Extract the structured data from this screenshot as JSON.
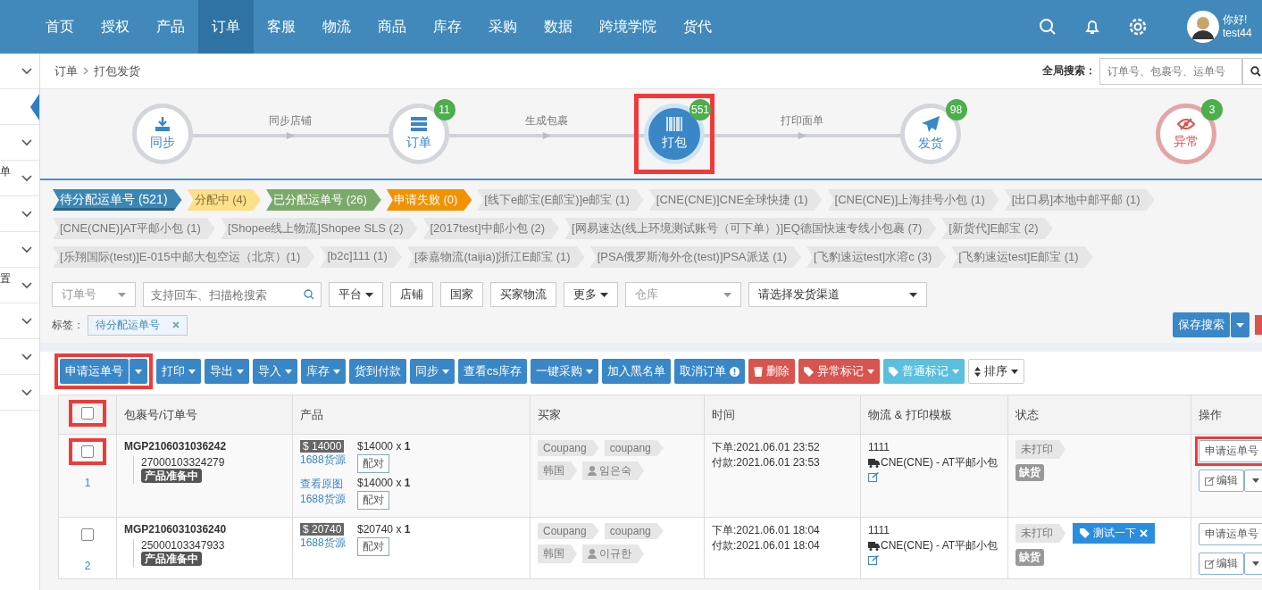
{
  "nav": {
    "items": [
      {
        "label": "首页",
        "selected": false
      },
      {
        "label": "授权",
        "selected": false
      },
      {
        "label": "产品",
        "selected": false
      },
      {
        "label": "订单",
        "selected": true
      },
      {
        "label": "客服",
        "selected": false
      },
      {
        "label": "物流",
        "selected": false
      },
      {
        "label": "商品",
        "selected": false
      },
      {
        "label": "库存",
        "selected": false
      },
      {
        "label": "采购",
        "selected": false
      },
      {
        "label": "数据",
        "selected": false
      },
      {
        "label": "跨境学院",
        "selected": false
      },
      {
        "label": "货代",
        "selected": false
      }
    ],
    "user": {
      "greeting": "你好!",
      "name": "test44"
    }
  },
  "sidebar": {
    "items": [
      {
        "kind": "chevron",
        "selected": false
      },
      {
        "kind": "blank",
        "selected": true
      },
      {
        "kind": "chevron",
        "selected": false
      },
      {
        "kind": "text",
        "text": "单",
        "selected": false
      },
      {
        "kind": "chevron",
        "selected": false
      },
      {
        "kind": "chevron",
        "selected": false
      },
      {
        "kind": "text",
        "text": "置",
        "selected": false
      },
      {
        "kind": "chevron",
        "selected": false
      },
      {
        "kind": "chevron",
        "selected": false
      },
      {
        "kind": "chevron",
        "selected": false
      }
    ]
  },
  "breadcrumb": [
    "订单",
    "打包发货"
  ],
  "global_search": {
    "label": "全局搜索：",
    "placeholder": "订单号、包裹号、运单号"
  },
  "steps": [
    {
      "label": "同步",
      "kind": "normal",
      "highlighted": false
    },
    {
      "label": "订单",
      "kind": "normal",
      "badge": "11",
      "connector": "同步店铺",
      "highlighted": false
    },
    {
      "label": "打包",
      "kind": "active",
      "badge": "551",
      "connector": "生成包裹",
      "highlighted": true
    },
    {
      "label": "发货",
      "kind": "normal",
      "badge": "98",
      "connector": "打印面单",
      "highlighted": false
    },
    {
      "label": "异常",
      "kind": "danger",
      "badge": "3",
      "highlighted": false
    }
  ],
  "status_tags": [
    {
      "label": "待分配运单号 (521)",
      "color": "#3a87b5",
      "selected": true
    },
    {
      "label": "分配中 (4)",
      "color": "#fde08a",
      "selected": false
    },
    {
      "label": "已分配运单号 (26)",
      "color": "#7aaa6a",
      "selected": false
    },
    {
      "label": "申请失败 (0)",
      "color": "#f39200",
      "selected": false
    },
    {
      "label": "[线下e邮宝(E邮宝)]e邮宝 (1)",
      "color": "#e6e6e6",
      "selected": false
    },
    {
      "label": "[CNE(CNE)]CNE全球快捷 (1)",
      "color": "#e6e6e6",
      "selected": false
    },
    {
      "label": "[CNE(CNE)]上海挂号小包 (1)",
      "color": "#e6e6e6",
      "selected": false
    },
    {
      "label": "[出口易]本地中邮平邮 (1)",
      "color": "#e6e6e6",
      "selected": false
    },
    {
      "label": "[CNE(CNE)]AT平邮小包 (1)",
      "color": "#e6e6e6",
      "selected": false
    },
    {
      "label": "[Shopee线上物流]Shopee SLS (2)",
      "color": "#e6e6e6",
      "selected": false
    },
    {
      "label": "[2017test]中邮小包 (2)",
      "color": "#e6e6e6",
      "selected": false
    },
    {
      "label": "[网易速达(线上环境测试账号（可下单）)]EQ德国快速专线小包裹 (7)",
      "color": "#e6e6e6",
      "selected": false
    },
    {
      "label": "[新货代]E邮宝 (2)",
      "color": "#e6e6e6",
      "selected": false
    },
    {
      "label": "[乐翔国际(test)]E-015中邮大包空运（北京）(1)",
      "color": "#e6e6e6",
      "selected": false
    },
    {
      "label": "[b2c]111 (1)",
      "color": "#e6e6e6",
      "selected": false
    },
    {
      "label": "[泰嘉物流(taijia)]浙江E邮宝 (1)",
      "color": "#e6e6e6",
      "selected": false
    },
    {
      "label": "[PSA俄罗斯海外仓(test)]PSA派送 (1)",
      "color": "#e6e6e6",
      "selected": false
    },
    {
      "label": "[飞豹速运test]水溶c (3)",
      "color": "#e6e6e6",
      "selected": false
    },
    {
      "label": "[飞豹速运test]E邮宝 (1)",
      "color": "#e6e6e6",
      "selected": false
    }
  ],
  "filters": [
    {
      "kind": "select",
      "placeholder": "订单号"
    },
    {
      "kind": "search",
      "placeholder": "支持回车、扫描枪搜索"
    },
    {
      "kind": "dropdown",
      "label": "平台"
    },
    {
      "kind": "button",
      "label": "店铺"
    },
    {
      "kind": "button",
      "label": "国家"
    },
    {
      "kind": "button",
      "label": "买家物流"
    },
    {
      "kind": "dropdown",
      "label": "更多"
    },
    {
      "kind": "select",
      "placeholder": "仓库"
    },
    {
      "kind": "select",
      "value": "请选择发货渠道"
    }
  ],
  "tag_filter": {
    "label": "标签：",
    "chips": [
      "待分配运单号"
    ]
  },
  "save_search": "保存搜索",
  "toolbar": [
    {
      "label": "申请运单号",
      "kind": "primary",
      "split": true,
      "highlighted": true
    },
    {
      "label": "打印",
      "kind": "primary",
      "dropdown": true
    },
    {
      "label": "导出",
      "kind": "primary",
      "dropdown": true
    },
    {
      "label": "导入",
      "kind": "primary",
      "dropdown": true
    },
    {
      "label": "库存",
      "kind": "primary",
      "dropdown": true
    },
    {
      "label": "货到付款",
      "kind": "primary"
    },
    {
      "label": "同步",
      "kind": "primary",
      "dropdown": true
    },
    {
      "label": "查看cs库存",
      "kind": "primary"
    },
    {
      "label": "一键采购",
      "kind": "primary",
      "dropdown": true
    },
    {
      "label": "加入黑名单",
      "kind": "primary"
    },
    {
      "label": "取消订单",
      "kind": "primary"
    },
    {
      "label": "删除",
      "kind": "danger"
    },
    {
      "label": "异常标记",
      "kind": "danger",
      "dropdown": true
    },
    {
      "label": "普通标记",
      "kind": "info",
      "dropdown": true
    },
    {
      "label": "排序",
      "kind": "default",
      "dropdown": true
    }
  ],
  "table": {
    "header_highlighted": true,
    "header_checked": false,
    "columns": [
      "包裹号/订单号",
      "产品",
      "买家",
      "时间",
      "物流 & 打印模板",
      "状态",
      "操作"
    ],
    "rows": [
      {
        "index": "1",
        "checked": false,
        "highlighted": true,
        "package_no": "MGP2106031036242",
        "order_no": "27000103324279",
        "order_status": "产品准备中",
        "products": [
          {
            "price_tag": "$ 14000",
            "source": "1688货源",
            "price": "$14000 x **1**",
            "match": "配对"
          },
          {
            "link": "查看原图",
            "source": "1688货源",
            "price": "$14000 x **1**",
            "match": "配对"
          }
        ],
        "buyer_tags": [
          "Coupang",
          "coupang",
          "韩国"
        ],
        "buyer_name": "임은숙",
        "times": [
          "下单:2021.06.01 23:52",
          "付款:2021.06.01 23:53"
        ],
        "logistics_code": "1111",
        "logistics_channel": "CNE(CNE) - AT平邮小包",
        "print_status": "未打印",
        "stock_status": "缺货",
        "action": "申请运单号",
        "action_highlighted": true,
        "edit": "编辑"
      },
      {
        "index": "2",
        "checked": false,
        "highlighted": false,
        "package_no": "MGP2106031036240",
        "order_no": "25000103347933",
        "order_status": "产品准备中",
        "products": [
          {
            "price_tag": "$ 20740",
            "source": "1688货源",
            "price": "$20740 x **1**",
            "match": "配对"
          }
        ],
        "buyer_tags": [
          "Coupang",
          "coupang",
          "韩国"
        ],
        "buyer_name": "이규한",
        "times": [
          "下单:2021.06.01 18:04",
          "付款:2021.06.01 18:04"
        ],
        "logistics_code": "1111",
        "logistics_channel": "CNE(CNE) - AT平邮小包",
        "print_status": "未打印",
        "custom_tag": "测试一下",
        "stock_status": "缺货",
        "action": "申请运单号",
        "action_highlighted": false,
        "edit": "编辑"
      }
    ]
  }
}
